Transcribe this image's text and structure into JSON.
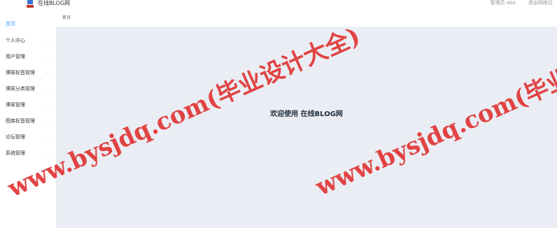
{
  "header": {
    "title": "在线BLOG网",
    "user_label": "管理员 abo",
    "logout_label": "退出网络日"
  },
  "sidebar": {
    "items": [
      {
        "label": "首页"
      },
      {
        "label": "个人中心"
      },
      {
        "label": "用户管理"
      },
      {
        "label": "博客标签管理"
      },
      {
        "label": "博客分类管理"
      },
      {
        "label": "博客管理"
      },
      {
        "label": "图库标签管理"
      },
      {
        "label": "论坛管理"
      },
      {
        "label": "系统管理"
      }
    ]
  },
  "tabs": [
    {
      "label": "首页"
    }
  ],
  "main": {
    "welcome": "欢迎使用 在线BLOG网"
  },
  "watermark": {
    "text": "www.bysjdq.com(毕业设计大全)",
    "color": "#e03030"
  },
  "colors": {
    "accent": "#409eff",
    "main_bg": "#eaedf3"
  }
}
